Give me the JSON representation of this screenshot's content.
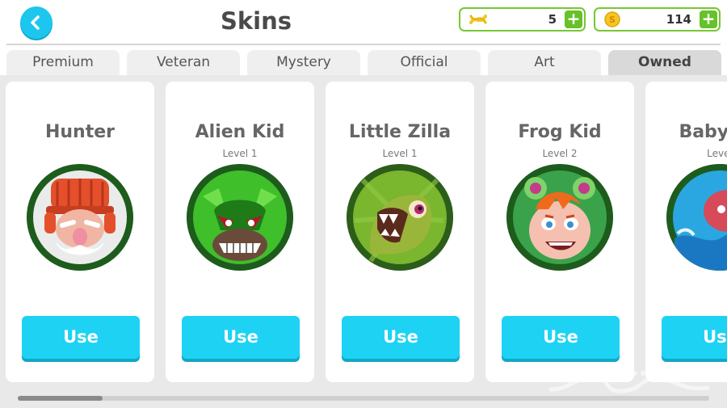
{
  "header": {
    "title": "Skins",
    "back_icon": "chevron-left-icon"
  },
  "currencies": [
    {
      "name": "dna",
      "icon": "dna-icon",
      "value": "5",
      "plus": "+"
    },
    {
      "name": "coins",
      "icon": "coin-icon",
      "value": "114",
      "plus": "+"
    }
  ],
  "tabs": [
    {
      "label": "Premium"
    },
    {
      "label": "Veteran"
    },
    {
      "label": "Mystery"
    },
    {
      "label": "Official"
    },
    {
      "label": "Art"
    },
    {
      "label": "Owned",
      "active": true
    }
  ],
  "skins": [
    {
      "name": "Hunter",
      "level": "",
      "button": "Use",
      "avatar": "hunter-avatar"
    },
    {
      "name": "Alien Kid",
      "level": "Level 1",
      "button": "Use",
      "avatar": "alien-kid-avatar"
    },
    {
      "name": "Little Zilla",
      "level": "Level 1",
      "button": "Use",
      "avatar": "little-zilla-avatar"
    },
    {
      "name": "Frog Kid",
      "level": "Level 2",
      "button": "Use",
      "avatar": "frog-kid-avatar"
    },
    {
      "name": "Baby Oc",
      "level": "Level",
      "button": "Use",
      "avatar": "baby-octopus-avatar"
    }
  ],
  "scroll": {
    "position_fraction": 0.0
  },
  "colors": {
    "accent_blue": "#1ed2f4",
    "currency_green": "#76c831",
    "active_tab": "#d9d9d9",
    "background": "#e9e9e9"
  }
}
